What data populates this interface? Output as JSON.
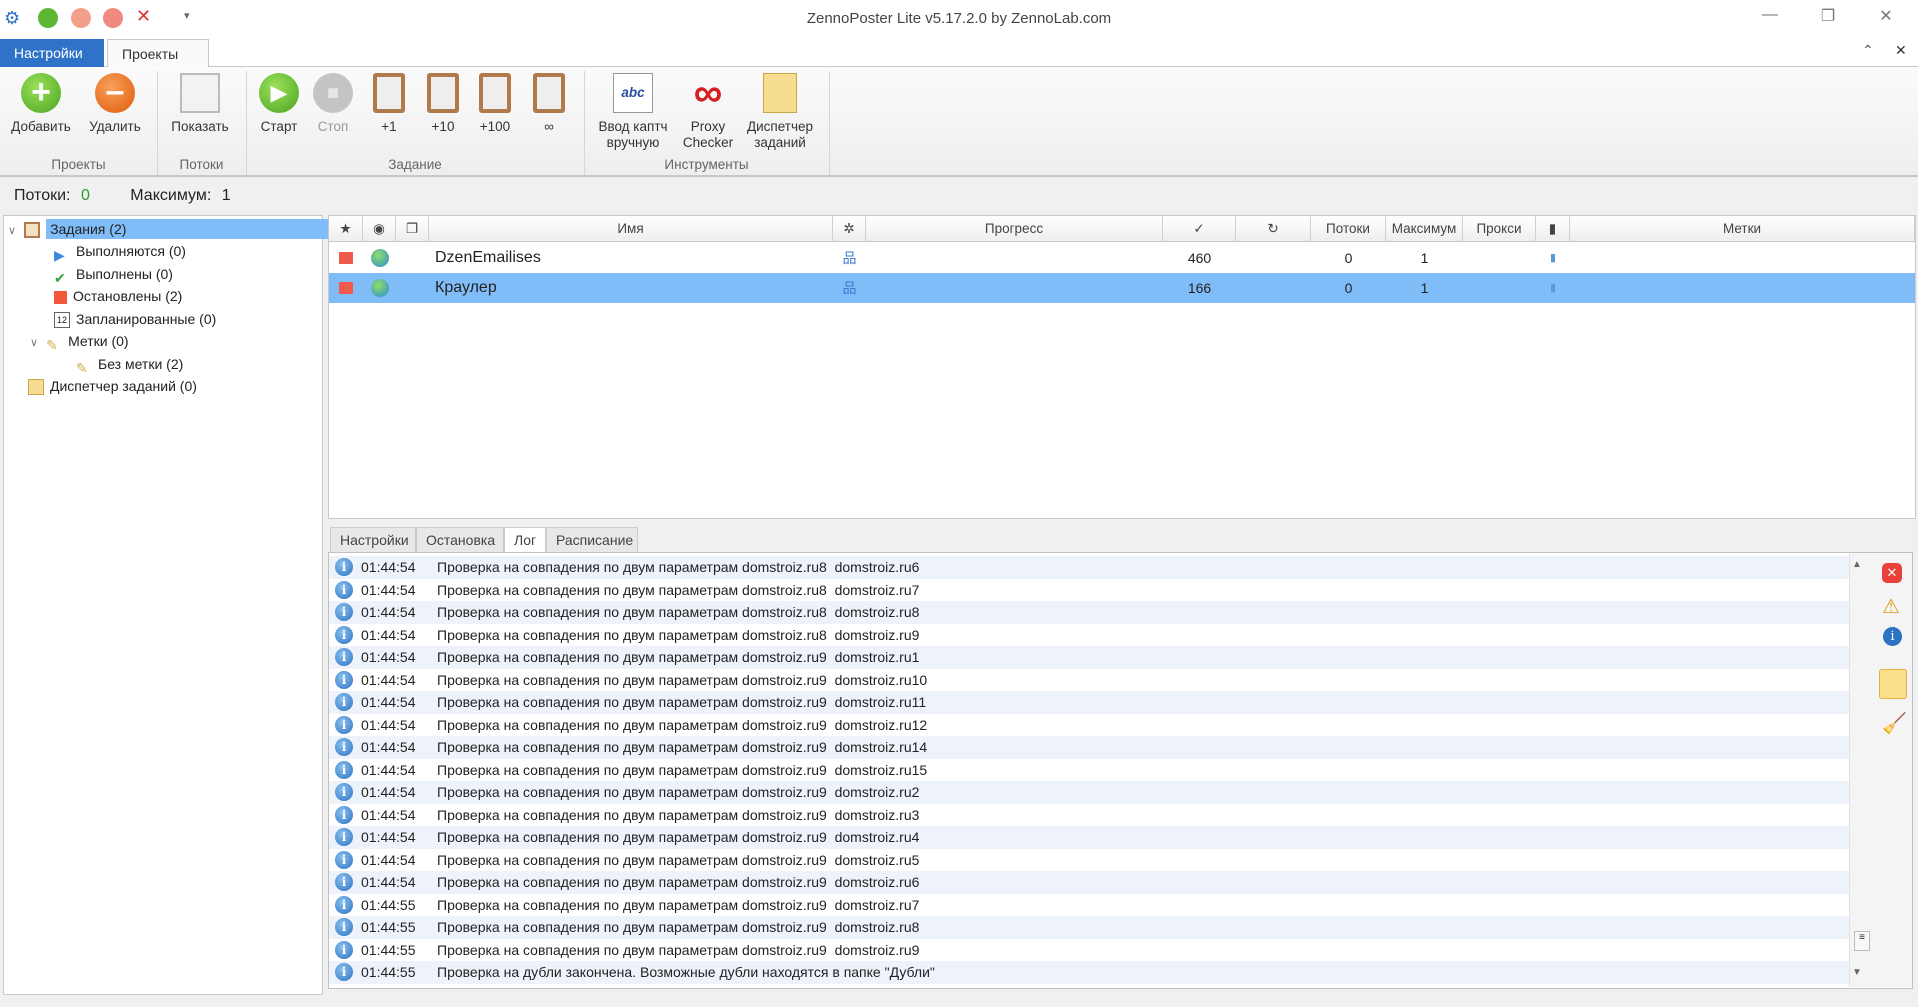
{
  "window": {
    "title": "ZennoPoster Lite v5.17.2.0 by ZennoLab.com"
  },
  "ribbon_tabs": [
    {
      "label": "Настройки"
    },
    {
      "label": "Проекты"
    }
  ],
  "ribbon": {
    "groups": [
      "Проекты",
      "Потоки",
      "Задание",
      "Инструменты"
    ],
    "buttons": {
      "add": "Добавить",
      "remove": "Удалить",
      "show": "Показать",
      "start": "Старт",
      "stop": "Стоп",
      "plus1": "+1",
      "plus10": "+10",
      "plus100": "+100",
      "infinite": "∞",
      "captcha1": "Ввод каптч",
      "captcha2": "вручную",
      "proxy1": "Proxy",
      "proxy2": "Checker",
      "disp1": "Диспетчер",
      "disp2": "заданий"
    }
  },
  "status": {
    "threads_label": "Потоки:",
    "threads": "0",
    "max_label": "Максимум:",
    "max": "1"
  },
  "tree": [
    "Задания (2)",
    "Выполняются (0)",
    "Выполнены (0)",
    "Остановлены (2)",
    "Запланированные (0)",
    "Метки (0)",
    "Без метки (2)",
    "Диспетчер заданий (0)"
  ],
  "grid": {
    "headers": {
      "name": "Имя",
      "progress": "Прогресс",
      "threads": "Потоки",
      "max": "Максимум",
      "proxy": "Прокси",
      "labels": "Метки"
    },
    "rows": [
      {
        "name": "DzenEmailises",
        "count": "460",
        "threads": "0",
        "max": "1"
      },
      {
        "name": "Краулер",
        "count": "166",
        "threads": "0",
        "max": "1"
      }
    ]
  },
  "bottom_tabs": [
    "Настройки",
    "Остановка",
    "Лог",
    "Расписание"
  ],
  "log": [
    [
      "01:44:54",
      "Проверка на совпадения по двум параметрам domstroiz.ru8  domstroiz.ru6"
    ],
    [
      "01:44:54",
      "Проверка на совпадения по двум параметрам domstroiz.ru8  domstroiz.ru7"
    ],
    [
      "01:44:54",
      "Проверка на совпадения по двум параметрам domstroiz.ru8  domstroiz.ru8"
    ],
    [
      "01:44:54",
      "Проверка на совпадения по двум параметрам domstroiz.ru8  domstroiz.ru9"
    ],
    [
      "01:44:54",
      "Проверка на совпадения по двум параметрам domstroiz.ru9  domstroiz.ru1"
    ],
    [
      "01:44:54",
      "Проверка на совпадения по двум параметрам domstroiz.ru9  domstroiz.ru10"
    ],
    [
      "01:44:54",
      "Проверка на совпадения по двум параметрам domstroiz.ru9  domstroiz.ru11"
    ],
    [
      "01:44:54",
      "Проверка на совпадения по двум параметрам domstroiz.ru9  domstroiz.ru12"
    ],
    [
      "01:44:54",
      "Проверка на совпадения по двум параметрам domstroiz.ru9  domstroiz.ru14"
    ],
    [
      "01:44:54",
      "Проверка на совпадения по двум параметрам domstroiz.ru9  domstroiz.ru15"
    ],
    [
      "01:44:54",
      "Проверка на совпадения по двум параметрам domstroiz.ru9  domstroiz.ru2"
    ],
    [
      "01:44:54",
      "Проверка на совпадения по двум параметрам domstroiz.ru9  domstroiz.ru3"
    ],
    [
      "01:44:54",
      "Проверка на совпадения по двум параметрам domstroiz.ru9  domstroiz.ru4"
    ],
    [
      "01:44:54",
      "Проверка на совпадения по двум параметрам domstroiz.ru9  domstroiz.ru5"
    ],
    [
      "01:44:54",
      "Проверка на совпадения по двум параметрам domstroiz.ru9  domstroiz.ru6"
    ],
    [
      "01:44:55",
      "Проверка на совпадения по двум параметрам domstroiz.ru9  domstroiz.ru7"
    ],
    [
      "01:44:55",
      "Проверка на совпадения по двум параметрам domstroiz.ru9  domstroiz.ru8"
    ],
    [
      "01:44:55",
      "Проверка на совпадения по двум параметрам domstroiz.ru9  domstroiz.ru9"
    ],
    [
      "01:44:55",
      "Проверка на дубли закончена. Возможные дубли находятся в папке \"Дубли\""
    ]
  ],
  "colors": {
    "accent": "#2f73c8",
    "selection": "#80bdf8",
    "threads_value": "#2aa02a"
  }
}
